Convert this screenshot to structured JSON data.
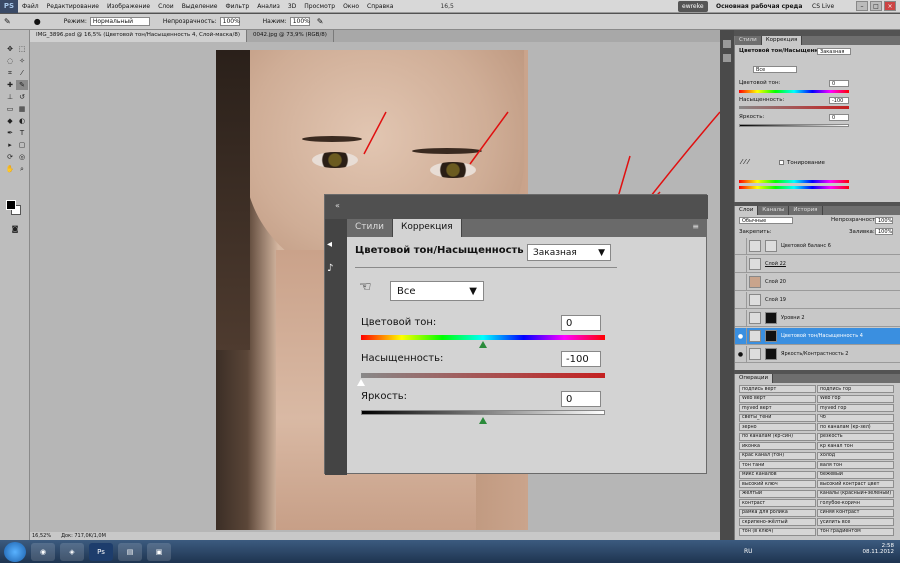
{
  "menu": {
    "logo": "PS",
    "items": [
      "Файл",
      "Редактирование",
      "Изображение",
      "Слои",
      "Выделение",
      "Фильтр",
      "Анализ",
      "3D",
      "Просмотр",
      "Окно",
      "Справка"
    ],
    "zoom": "16,5",
    "workspace_user": "ewreke",
    "workspace": "Основная рабочая среда",
    "cs_live": "CS Live"
  },
  "options": {
    "mode_label": "Режим:",
    "mode_value": "Нормальный",
    "opacity_label": "Непрозрачность:",
    "opacity_value": "100%",
    "pressure_label": "Нажим:",
    "pressure_value": "100%"
  },
  "tabs": [
    "IMG_3896.psd @ 16,5% (Цветовой тон/Насыщенность 4, Слой-маска/8)",
    "0042.jpg @ 73,9% (RGB/8)"
  ],
  "status": {
    "zoom": "16,52%",
    "doc": "Док: 717,0K/1,0M"
  },
  "adjust_panel": {
    "tab_styles": "Стили",
    "tab_correction": "Коррекция",
    "title": "Цветовой тон/Насыщенность",
    "preset": "Заказная",
    "channel": "Все",
    "hue_label": "Цветовой тон:",
    "hue_value": "0",
    "hue_position": 0.5,
    "saturation_label": "Насыщенность:",
    "saturation_value": "-100",
    "saturation_position": 0.0,
    "lightness_label": "Яркость:",
    "lightness_value": "0",
    "lightness_position": 0.5
  },
  "right_adjust": {
    "tab_styles": "Стили",
    "tab_correction": "Коррекция",
    "title": "Цветовой тон/Насыщенность",
    "preset": "Заказная",
    "channel": "Все",
    "hue_label": "Цветовой тон:",
    "hue_value": "0",
    "saturation_label": "Насыщенность:",
    "saturation_value": "-100",
    "lightness_label": "Яркость:",
    "lightness_value": "0",
    "colorize_label": "Тонирование"
  },
  "layers": {
    "tabs": [
      "Слои",
      "Каналы",
      "История"
    ],
    "blend": "Обычные",
    "opacity_label": "Непрозрачность:",
    "opacity_value": "100%",
    "lock_label": "Закрепить:",
    "fill_label": "Заливка:",
    "fill_value": "100%",
    "rows": [
      {
        "name": "Цветовой баланс 6",
        "selected": false,
        "dark": false
      },
      {
        "name": "Слой 22",
        "selected": false,
        "dark": false
      },
      {
        "name": "Слой 20",
        "selected": false,
        "dark": false
      },
      {
        "name": "Слой 19",
        "selected": false,
        "dark": false
      },
      {
        "name": "Уровни 2",
        "selected": false,
        "dark": true
      },
      {
        "name": "Цветовой тон/Насыщенность 4",
        "selected": true,
        "dark": true
      },
      {
        "name": "Яркость/Контрастность 2",
        "selected": false,
        "dark": true
      }
    ]
  },
  "actions": {
    "tab": "Операции",
    "cells": [
      [
        "подпись верт",
        "подпись гор"
      ],
      [
        "Web верт",
        "Web гор"
      ],
      [
        "myved верт",
        "myved гор"
      ],
      [
        "светы_тени",
        "чб"
      ],
      [
        "зерно",
        "по каналам (кр-зел)"
      ],
      [
        "по каналам (кр-син)",
        "резкость"
      ],
      [
        "иконка",
        "кр канал тон"
      ],
      [
        "крас канал (тон)",
        "холод"
      ],
      [
        "тон тани",
        "валя тон"
      ],
      [
        "микс каналов",
        "бежевый"
      ],
      [
        "высокий ключ",
        "высокий контраст цвет"
      ],
      [
        "жёлтый",
        "каналы (красный+зеленый)"
      ],
      [
        "контраст",
        "голубое-коричн"
      ],
      [
        "рамка для ролика",
        "синяя контраст"
      ],
      [
        "скрипено-жёлтый",
        "усилить все"
      ],
      [
        "тон (в ключ)",
        "тон градиентом"
      ]
    ]
  },
  "taskbar": {
    "lang": "RU",
    "time": "2:58",
    "date": "08.11.2012",
    "ps_label": "Ps"
  },
  "icons": {
    "dropdown": "▼",
    "collapse": "«",
    "eye": "●",
    "hand": "☜"
  }
}
